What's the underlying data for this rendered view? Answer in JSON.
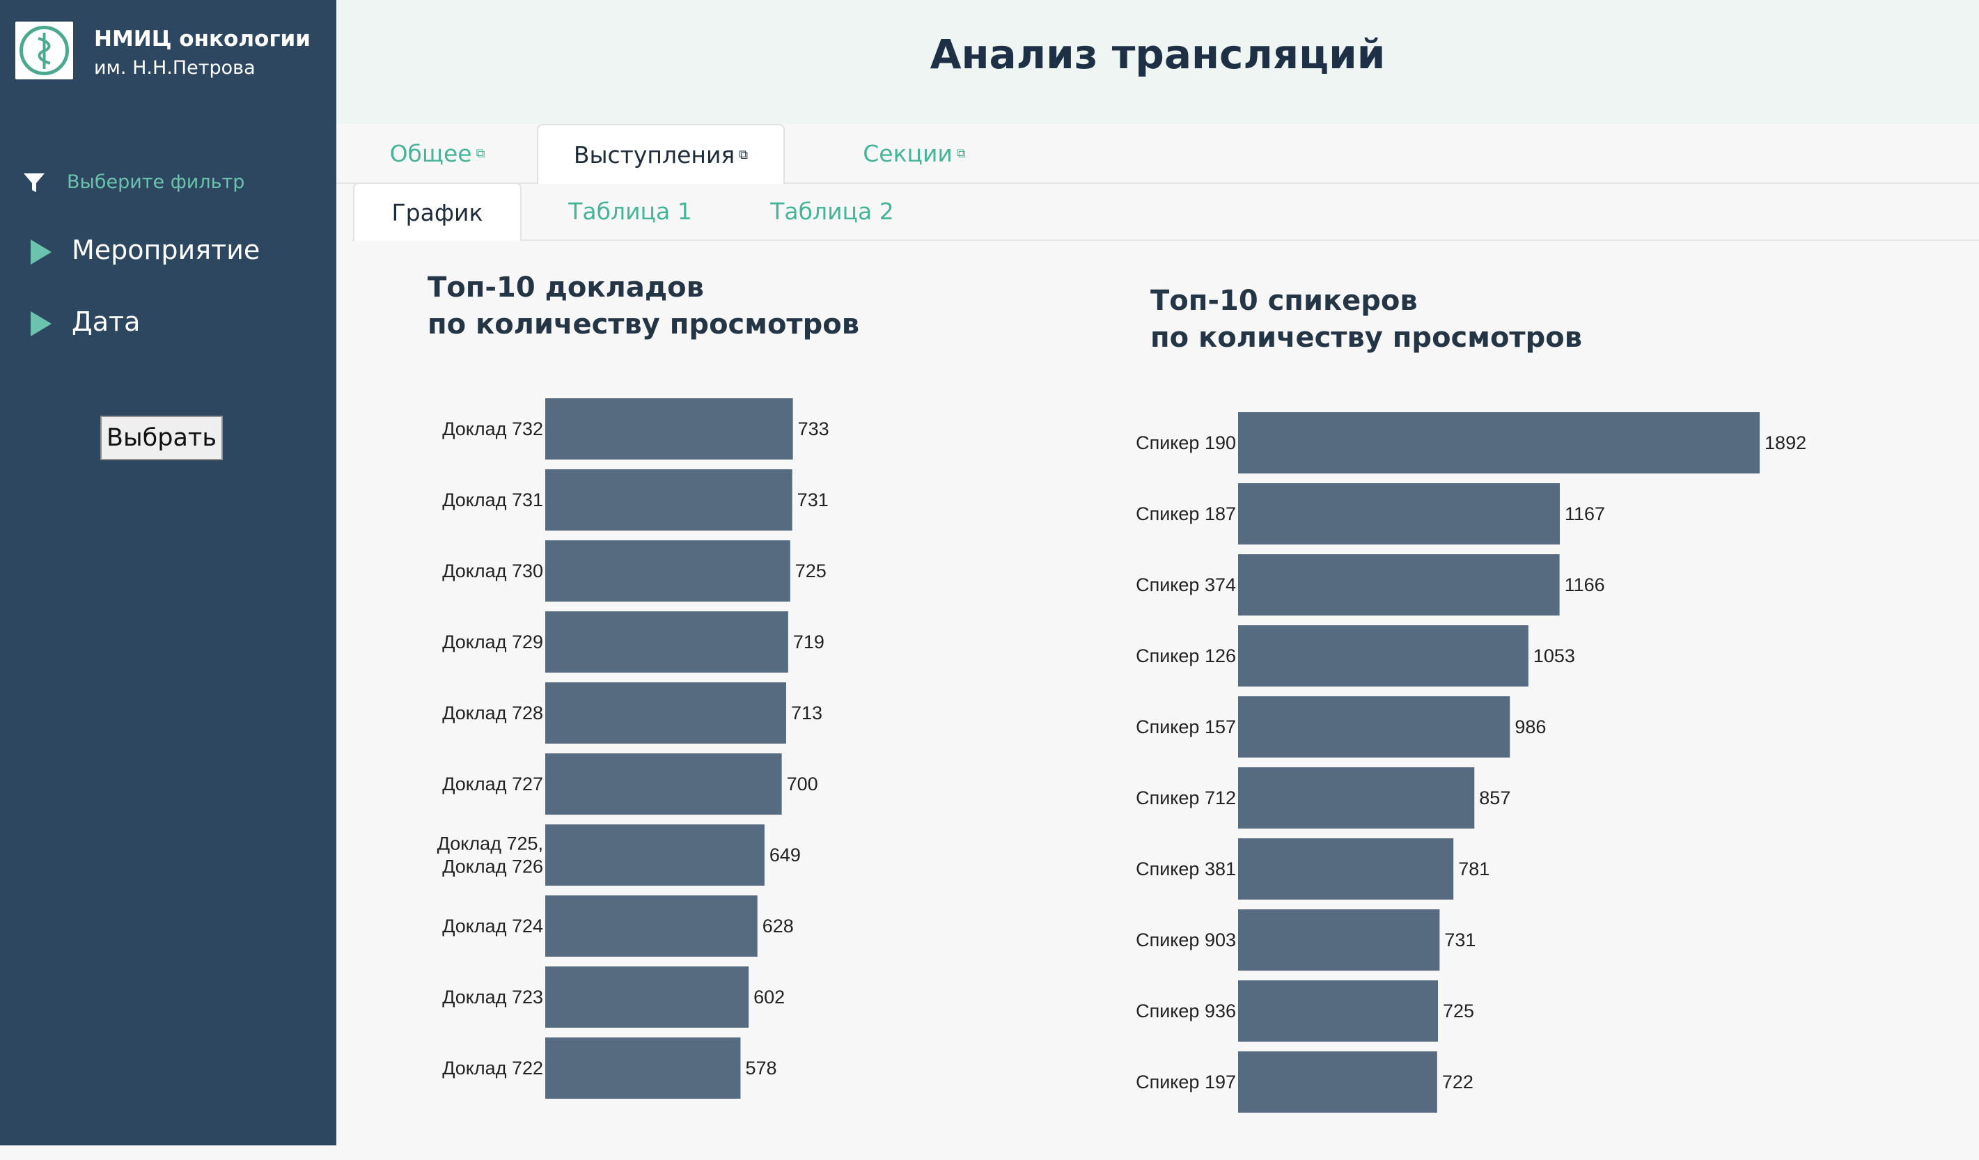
{
  "sidebar": {
    "org_name": "НМИЦ онкологии",
    "org_subtitle": "им. Н.Н.Петрова",
    "filter_label": "Выберите фильтр",
    "items": [
      {
        "label": "Мероприятие"
      },
      {
        "label": "Дата"
      }
    ],
    "apply_button": "Выбрать"
  },
  "header": {
    "title": "Анализ трансляций"
  },
  "tabs": [
    {
      "label": "Общее",
      "active": false
    },
    {
      "label": "Выступления",
      "active": true
    },
    {
      "label": "Секции",
      "active": false
    }
  ],
  "subtabs": [
    {
      "label": "График",
      "active": true
    },
    {
      "label": "Таблица 1",
      "active": false
    },
    {
      "label": "Таблица 2",
      "active": false
    }
  ],
  "colors": {
    "sidebar_bg": "#2d4760",
    "accent": "#45b497",
    "bar": "#576b80"
  },
  "chart_data": [
    {
      "type": "bar",
      "orientation": "horizontal",
      "title_line1": "Топ-10 докладов",
      "title_line2": "по количеству просмотров",
      "categories": [
        "Доклад 732",
        "Доклад 731",
        "Доклад 730",
        "Доклад 729",
        "Доклад 728",
        "Доклад 727",
        "Доклад 725,|Доклад 726",
        "Доклад 724",
        "Доклад 723",
        "Доклад 722"
      ],
      "values": [
        733,
        731,
        725,
        719,
        713,
        700,
        649,
        628,
        602,
        578
      ]
    },
    {
      "type": "bar",
      "orientation": "horizontal",
      "title_line1": "Топ-10 спикеров",
      "title_line2": "по количеству просмотров",
      "categories": [
        "Спикер 190",
        "Спикер 187",
        "Спикер 374",
        "Спикер 126",
        "Спикер 157",
        "Спикер 712",
        "Спикер 381",
        "Спикер 903",
        "Спикер 936",
        "Спикер 197"
      ],
      "values": [
        1892,
        1167,
        1166,
        1053,
        986,
        857,
        781,
        731,
        725,
        722
      ]
    }
  ]
}
